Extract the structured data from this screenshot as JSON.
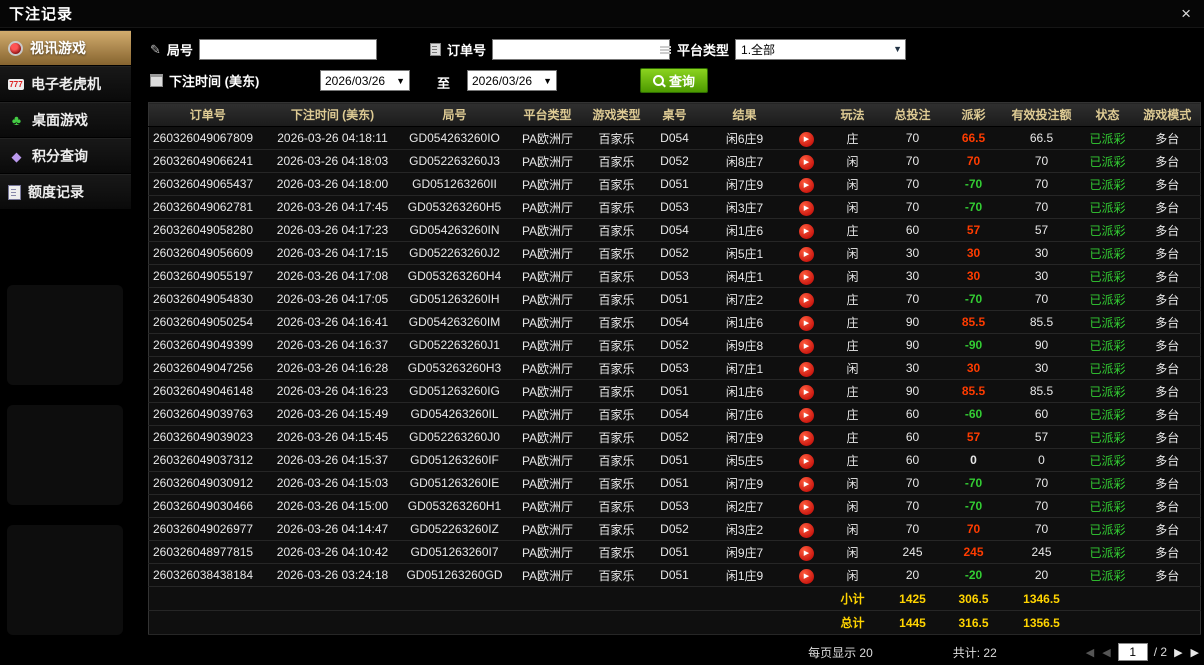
{
  "window": {
    "title": "下注记录",
    "close_icon": "×"
  },
  "sidebar": {
    "items": [
      {
        "id": "video-games",
        "label": "视讯游戏",
        "icon": "camera-icon",
        "active": true
      },
      {
        "id": "slot-machines",
        "label": "电子老虎机",
        "icon": "slots-icon",
        "active": false
      },
      {
        "id": "table-games",
        "label": "桌面游戏",
        "icon": "cards-icon",
        "active": false
      },
      {
        "id": "points-query",
        "label": "积分查询",
        "icon": "gem-icon",
        "active": false
      },
      {
        "id": "quota-records",
        "label": "额度记录",
        "icon": "ledger-icon",
        "active": false
      }
    ]
  },
  "filters": {
    "round_label": "局号",
    "round_value": "",
    "order_label": "订单号",
    "order_value": "",
    "platform_label": "平台类型",
    "platform_value": "1.全部",
    "time_label": "下注时间 (美东)",
    "date_from": "2026/03/26",
    "to_label": "至",
    "date_to": "2026/03/26",
    "query_label": "查询"
  },
  "table": {
    "headers": [
      "订单号",
      "下注时间 (美东)",
      "局号",
      "平台类型",
      "游戏类型",
      "桌号",
      "结果",
      "",
      "玩法",
      "总投注",
      "派彩",
      "有效投注额",
      "状态",
      "游戏模式"
    ],
    "rows": [
      [
        "260326049067809",
        "2026-03-26 04:18:11",
        "GD054263260IO",
        "PA欧洲厅",
        "百家乐",
        "D054",
        "闲6庄9",
        "庄",
        "70",
        "66.5",
        "66.5",
        "已派彩",
        "多台"
      ],
      [
        "260326049066241",
        "2026-03-26 04:18:03",
        "GD052263260J3",
        "PA欧洲厅",
        "百家乐",
        "D052",
        "闲8庄7",
        "闲",
        "70",
        "70",
        "70",
        "已派彩",
        "多台"
      ],
      [
        "260326049065437",
        "2026-03-26 04:18:00",
        "GD051263260II",
        "PA欧洲厅",
        "百家乐",
        "D051",
        "闲7庄9",
        "闲",
        "70",
        "-70",
        "70",
        "已派彩",
        "多台"
      ],
      [
        "260326049062781",
        "2026-03-26 04:17:45",
        "GD053263260H5",
        "PA欧洲厅",
        "百家乐",
        "D053",
        "闲3庄7",
        "闲",
        "70",
        "-70",
        "70",
        "已派彩",
        "多台"
      ],
      [
        "260326049058280",
        "2026-03-26 04:17:23",
        "GD054263260IN",
        "PA欧洲厅",
        "百家乐",
        "D054",
        "闲1庄6",
        "庄",
        "60",
        "57",
        "57",
        "已派彩",
        "多台"
      ],
      [
        "260326049056609",
        "2026-03-26 04:17:15",
        "GD052263260J2",
        "PA欧洲厅",
        "百家乐",
        "D052",
        "闲5庄1",
        "闲",
        "30",
        "30",
        "30",
        "已派彩",
        "多台"
      ],
      [
        "260326049055197",
        "2026-03-26 04:17:08",
        "GD053263260H4",
        "PA欧洲厅",
        "百家乐",
        "D053",
        "闲4庄1",
        "闲",
        "30",
        "30",
        "30",
        "已派彩",
        "多台"
      ],
      [
        "260326049054830",
        "2026-03-26 04:17:05",
        "GD051263260IH",
        "PA欧洲厅",
        "百家乐",
        "D051",
        "闲7庄2",
        "庄",
        "70",
        "-70",
        "70",
        "已派彩",
        "多台"
      ],
      [
        "260326049050254",
        "2026-03-26 04:16:41",
        "GD054263260IM",
        "PA欧洲厅",
        "百家乐",
        "D054",
        "闲1庄6",
        "庄",
        "90",
        "85.5",
        "85.5",
        "已派彩",
        "多台"
      ],
      [
        "260326049049399",
        "2026-03-26 04:16:37",
        "GD052263260J1",
        "PA欧洲厅",
        "百家乐",
        "D052",
        "闲9庄8",
        "庄",
        "90",
        "-90",
        "90",
        "已派彩",
        "多台"
      ],
      [
        "260326049047256",
        "2026-03-26 04:16:28",
        "GD053263260H3",
        "PA欧洲厅",
        "百家乐",
        "D053",
        "闲7庄1",
        "闲",
        "30",
        "30",
        "30",
        "已派彩",
        "多台"
      ],
      [
        "260326049046148",
        "2026-03-26 04:16:23",
        "GD051263260IG",
        "PA欧洲厅",
        "百家乐",
        "D051",
        "闲1庄6",
        "庄",
        "90",
        "85.5",
        "85.5",
        "已派彩",
        "多台"
      ],
      [
        "260326049039763",
        "2026-03-26 04:15:49",
        "GD054263260IL",
        "PA欧洲厅",
        "百家乐",
        "D054",
        "闲7庄6",
        "庄",
        "60",
        "-60",
        "60",
        "已派彩",
        "多台"
      ],
      [
        "260326049039023",
        "2026-03-26 04:15:45",
        "GD052263260J0",
        "PA欧洲厅",
        "百家乐",
        "D052",
        "闲7庄9",
        "庄",
        "60",
        "57",
        "57",
        "已派彩",
        "多台"
      ],
      [
        "260326049037312",
        "2026-03-26 04:15:37",
        "GD051263260IF",
        "PA欧洲厅",
        "百家乐",
        "D051",
        "闲5庄5",
        "庄",
        "60",
        "0",
        "0",
        "已派彩",
        "多台"
      ],
      [
        "260326049030912",
        "2026-03-26 04:15:03",
        "GD051263260IE",
        "PA欧洲厅",
        "百家乐",
        "D051",
        "闲7庄9",
        "闲",
        "70",
        "-70",
        "70",
        "已派彩",
        "多台"
      ],
      [
        "260326049030466",
        "2026-03-26 04:15:00",
        "GD053263260H1",
        "PA欧洲厅",
        "百家乐",
        "D053",
        "闲2庄7",
        "闲",
        "70",
        "-70",
        "70",
        "已派彩",
        "多台"
      ],
      [
        "260326049026977",
        "2026-03-26 04:14:47",
        "GD052263260IZ",
        "PA欧洲厅",
        "百家乐",
        "D052",
        "闲3庄2",
        "闲",
        "70",
        "70",
        "70",
        "已派彩",
        "多台"
      ],
      [
        "260326048977815",
        "2026-03-26 04:10:42",
        "GD051263260I7",
        "PA欧洲厅",
        "百家乐",
        "D051",
        "闲9庄7",
        "闲",
        "245",
        "245",
        "245",
        "已派彩",
        "多台"
      ],
      [
        "260326038438184",
        "2026-03-26 03:24:18",
        "GD051263260GD",
        "PA欧洲厅",
        "百家乐",
        "D051",
        "闲1庄9",
        "闲",
        "20",
        "-20",
        "20",
        "已派彩",
        "多台"
      ]
    ],
    "subtotal": {
      "label": "小计",
      "total_bet": "1425",
      "payout": "306.5",
      "valid_bet": "1346.5"
    },
    "grand_total": {
      "label": "总计",
      "total_bet": "1445",
      "payout": "316.5",
      "valid_bet": "1356.5"
    }
  },
  "pagination": {
    "per_page_label": "每页显示 20",
    "total_label": "共计: 22",
    "page": "1",
    "pages_suffix": "/ 2"
  },
  "colors": {
    "positive-payout": "#ff3c00",
    "negative-payout": "#33cc33",
    "status-paid": "#33cc33",
    "summary-text": "#ffd400",
    "header-text": "#decb94",
    "query-top": "#8bd31f",
    "query-bottom": "#4d9a00",
    "active-tab-top": "#d2ac6e",
    "active-tab-bottom": "#86642f"
  }
}
